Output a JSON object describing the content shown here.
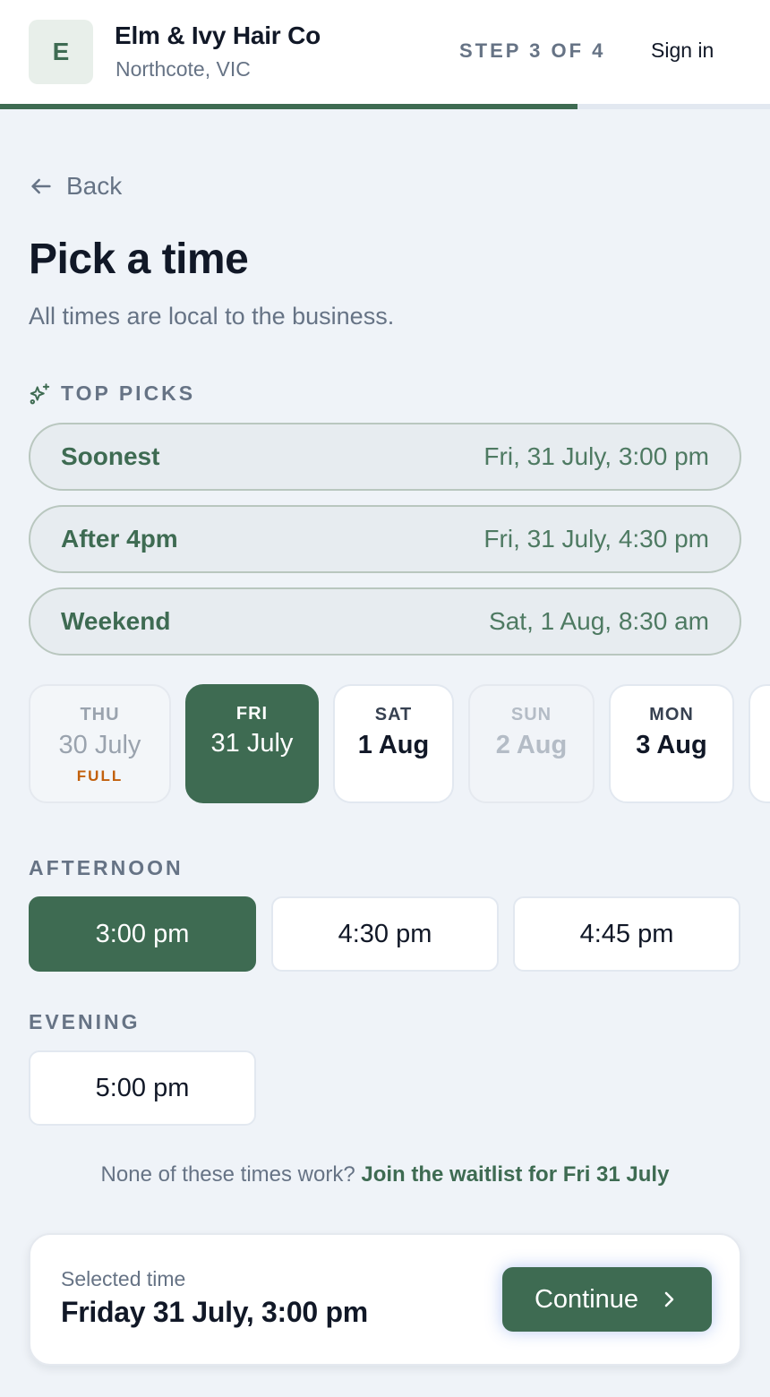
{
  "header": {
    "logo_letter": "E",
    "business_name": "Elm & Ivy Hair Co",
    "location": "Northcote, VIC",
    "step_label": "STEP 3 OF 4",
    "sign_in": "Sign in",
    "progress": 0.75
  },
  "nav": {
    "back_label": "Back"
  },
  "page": {
    "title": "Pick a time",
    "subtitle": "All times are local to the business."
  },
  "top_picks": {
    "label": "TOP PICKS",
    "items": [
      {
        "name": "Soonest",
        "time": "Fri, 31 July, 3:00 pm"
      },
      {
        "name": "After 4pm",
        "time": "Fri, 31 July, 4:30 pm"
      },
      {
        "name": "Weekend",
        "time": "Sat, 1 Aug, 8:30 am"
      }
    ]
  },
  "days": [
    {
      "dow": "THU",
      "date": "30 July",
      "note": "FULL",
      "state": "full"
    },
    {
      "dow": "FRI",
      "date": "31 July",
      "state": "selected"
    },
    {
      "dow": "SAT",
      "date": "1 Aug",
      "state": "available"
    },
    {
      "dow": "SUN",
      "date": "2 Aug",
      "state": "closed"
    },
    {
      "dow": "MON",
      "date": "3 Aug",
      "state": "available"
    }
  ],
  "afternoon": {
    "label": "AFTERNOON",
    "slots": [
      "3:00 pm",
      "4:30 pm",
      "4:45 pm"
    ],
    "selected_index": 0
  },
  "evening": {
    "label": "EVENING",
    "slots": [
      "5:00 pm"
    ]
  },
  "waitlist": {
    "prompt": "None of these times work?",
    "link": "Join the waitlist for Fri 31 July"
  },
  "footer": {
    "selected_label": "Selected time",
    "selected_value": "Friday 31 July, 3:00 pm",
    "continue_label": "Continue"
  },
  "colors": {
    "accent": "#3e6b52",
    "background": "#eff3f8",
    "full_text": "#c2600c"
  },
  "icons": {
    "back": "arrow-left-icon",
    "top_picks": "sparkles-icon",
    "continue": "chevron-right-icon"
  }
}
